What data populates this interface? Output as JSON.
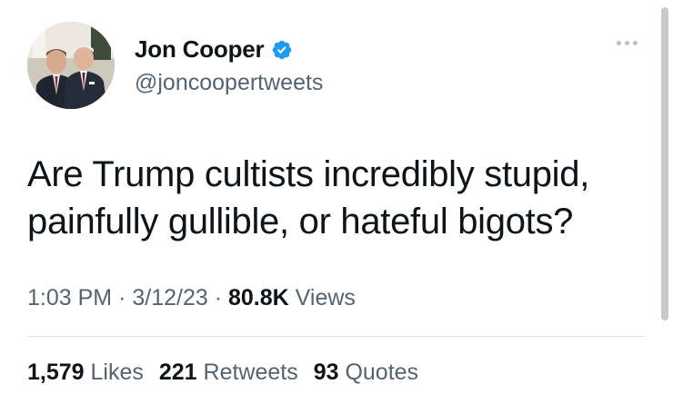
{
  "author": {
    "display_name": "Jon Cooper",
    "handle": "@joncoopertweets",
    "verified_icon": "verified-badge-icon",
    "avatar_alt": "profile photo"
  },
  "tweet": {
    "text": "Are Trump cultists incredibly stupid, painfully gullible, or hateful bigots?"
  },
  "meta": {
    "time": "1:03 PM",
    "date": "3/12/23",
    "views_count": "80.8K",
    "views_label": "Views"
  },
  "stats": {
    "likes_count": "1,579",
    "likes_label": "Likes",
    "retweets_count": "221",
    "retweets_label": "Retweets",
    "quotes_count": "93",
    "quotes_label": "Quotes"
  },
  "colors": {
    "verified_blue": "#1d9bf0",
    "text_primary": "#0f1419",
    "text_secondary": "#536471"
  }
}
